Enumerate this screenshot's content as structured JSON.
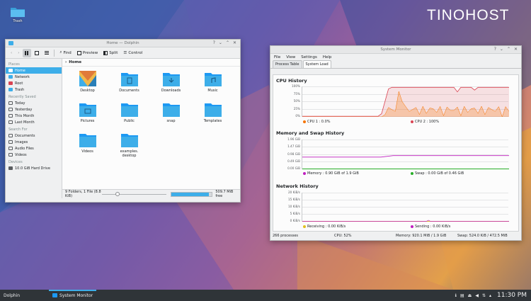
{
  "desktop": {
    "trash_label": "Trash",
    "logo_text": "TINOHOST"
  },
  "dolphin": {
    "title": "Home — Dolphin",
    "toolbar": {
      "find": "Find",
      "preview": "Preview",
      "split": "Split",
      "control": "Control"
    },
    "breadcrumb": "Home",
    "sidebar": {
      "places_header": "Places",
      "places": [
        {
          "label": "Home",
          "color": "#3daee9"
        },
        {
          "label": "Network",
          "color": "#3daee9"
        },
        {
          "label": "Root",
          "color": "#da4453"
        },
        {
          "label": "Trash",
          "color": "#3daee9"
        }
      ],
      "recent_header": "Recently Saved",
      "recent": [
        {
          "label": "Today"
        },
        {
          "label": "Yesterday"
        },
        {
          "label": "This Month"
        },
        {
          "label": "Last Month"
        }
      ],
      "search_header": "Search For",
      "search": [
        {
          "label": "Documents"
        },
        {
          "label": "Images"
        },
        {
          "label": "Audio Files"
        },
        {
          "label": "Videos"
        }
      ],
      "devices_header": "Devices",
      "devices": [
        {
          "label": "10.0 GiB Hard Drive"
        }
      ]
    },
    "files": [
      {
        "name": "Desktop",
        "icon": "desktop-folder-icon"
      },
      {
        "name": "Documents",
        "icon": "documents-folder-icon"
      },
      {
        "name": "Downloads",
        "icon": "downloads-folder-icon"
      },
      {
        "name": "Music",
        "icon": "music-folder-icon"
      },
      {
        "name": "Pictures",
        "icon": "pictures-folder-icon"
      },
      {
        "name": "Public",
        "icon": "public-folder-icon"
      },
      {
        "name": "snap",
        "icon": "folder-icon"
      },
      {
        "name": "Templates",
        "icon": "templates-folder-icon"
      },
      {
        "name": "Videos",
        "icon": "videos-folder-icon"
      },
      {
        "name": "examples.\ndesktop",
        "icon": "desktop-file-icon"
      }
    ],
    "status": {
      "summary": "9 Folders, 1 File (8.8 KiB)",
      "zoom_fraction": 0.2,
      "free_space": "509.7 MiB free",
      "used_fraction": 0.92
    }
  },
  "sysmon": {
    "title": "System Monitor",
    "menu": [
      "File",
      "View",
      "Settings",
      "Help"
    ],
    "tabs": [
      "Process Table",
      "System Load"
    ],
    "active_tab": 1,
    "cpu": {
      "title": "CPU History",
      "yticks": [
        "100%",
        "75%",
        "50%",
        "25%",
        "0%"
      ],
      "legend": [
        {
          "label": "CPU 1 : 0.0%",
          "color": "#f67400"
        },
        {
          "label": "CPU 2 : 100%",
          "color": "#da4453"
        }
      ]
    },
    "memory": {
      "title": "Memory and Swap History",
      "yticks": [
        "1.96 GiB",
        "1.47 GiB",
        "0.98 GiB",
        "0.49 GiB",
        "0.00 GiB"
      ],
      "legend": [
        {
          "label": "Memory : 0.90 GiB of 1.9 GiB",
          "color": "#c01fc0"
        },
        {
          "label": "Swap : 0.00 GiB of 0.46 GiB",
          "color": "#27ae27"
        }
      ]
    },
    "network": {
      "title": "Network History",
      "yticks": [
        "20 KiB/s",
        "15 KiB/s",
        "10 KiB/s",
        "5 KiB/s",
        "0 KiB/s"
      ],
      "legend": [
        {
          "label": "Receiving : 0.00 KiB/s",
          "color": "#e0c020"
        },
        {
          "label": "Sending : 0.00 KiB/s",
          "color": "#c01fc0"
        }
      ]
    },
    "status": {
      "processes": "266 processes",
      "cpu": "CPU: 52%",
      "memory": "Memory: 920.1 MiB / 1.9 GiB",
      "swap": "Swap: 524.0 KiB / 472.5 MiB"
    }
  },
  "taskbar": {
    "tasks": [
      {
        "label": "Dolphin"
      },
      {
        "label": "System Monitor"
      }
    ],
    "clock": "11:30 PM"
  }
}
